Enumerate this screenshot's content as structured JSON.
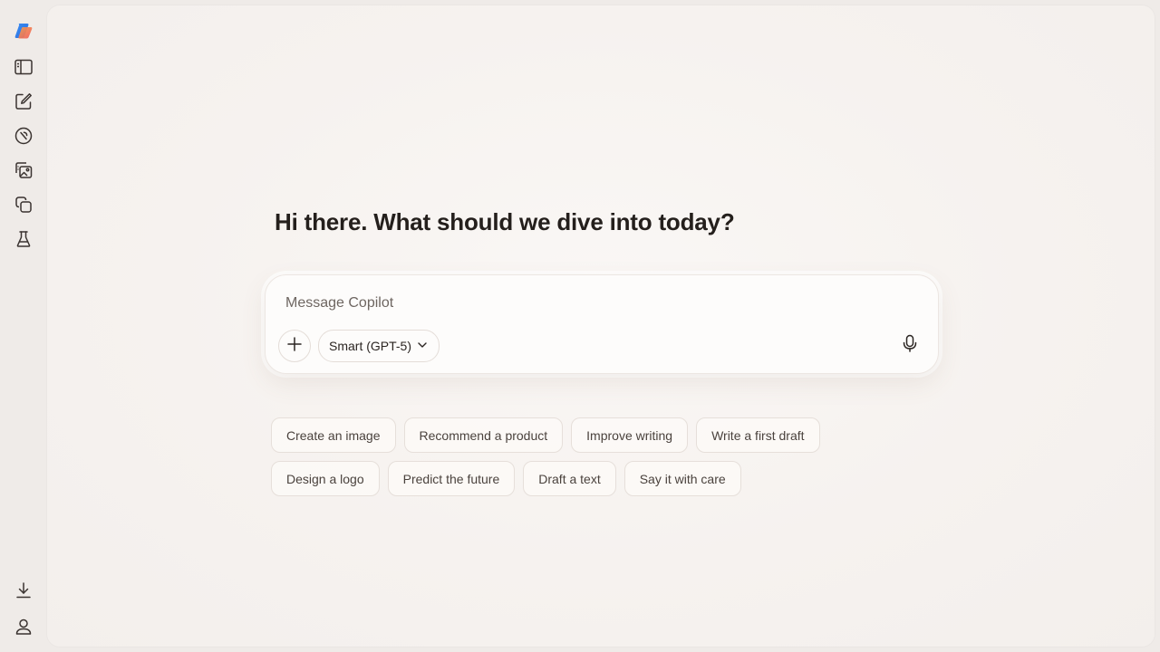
{
  "rail": {
    "items": [
      {
        "name": "copilot-logo-icon"
      },
      {
        "name": "sidebar-toggle-icon"
      },
      {
        "name": "new-chat-icon"
      },
      {
        "name": "discover-icon"
      },
      {
        "name": "images-icon"
      },
      {
        "name": "pages-icon"
      },
      {
        "name": "labs-icon"
      }
    ],
    "bottom": [
      {
        "name": "download-icon"
      },
      {
        "name": "profile-icon"
      }
    ]
  },
  "main": {
    "greeting": "Hi there. What should we dive into today?"
  },
  "composer": {
    "placeholder": "Message Copilot",
    "value": "",
    "model_label": "Smart (GPT-5)",
    "model_icon": "chevron-down-icon",
    "add_icon": "plus-icon",
    "mic_icon": "microphone-icon"
  },
  "suggestions": {
    "row1": [
      "Create an image",
      "Recommend a product",
      "Improve writing",
      "Write a first draft"
    ],
    "row2": [
      "Design a logo",
      "Predict the future",
      "Draft a text",
      "Say it with care"
    ]
  },
  "colors": {
    "background": "#efebe8",
    "panel": "#f6f2ef",
    "composer": "#fdfcfb",
    "text": "#241f1c",
    "icon": "#3a3330",
    "logo_blue": "#3f8ef0",
    "logo_orange": "#f0704a"
  }
}
